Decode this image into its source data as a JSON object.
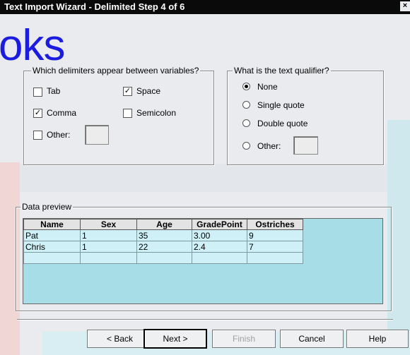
{
  "window": {
    "title": "Text Import Wizard - Delimited Step 4 of 6",
    "close_glyph": "×"
  },
  "watermark_text": "oks",
  "delimiters": {
    "legend": "Which delimiters appear between variables?",
    "tab": {
      "label": "Tab",
      "checked": false
    },
    "space": {
      "label": "Space",
      "checked": true
    },
    "comma": {
      "label": "Comma",
      "checked": true
    },
    "semicolon": {
      "label": "Semicolon",
      "checked": false
    },
    "other": {
      "label": "Other:",
      "checked": false,
      "value": ""
    },
    "check_glyph": "✓"
  },
  "qualifier": {
    "legend": "What is the text qualifier?",
    "options": [
      {
        "label": "None",
        "selected": true
      },
      {
        "label": "Single quote",
        "selected": false
      },
      {
        "label": "Double quote",
        "selected": false
      },
      {
        "label": "Other:",
        "selected": false
      }
    ],
    "other_value": ""
  },
  "preview": {
    "legend": "Data preview",
    "columns": [
      "Name",
      "Sex",
      "Age",
      "GradePoint",
      "Ostriches"
    ],
    "rows": [
      [
        "Pat",
        "1",
        "35",
        "3.00",
        "9"
      ],
      [
        "Chris",
        "1",
        "22",
        "2.4",
        "7"
      ],
      [
        "",
        "",
        "",
        "",
        ""
      ]
    ]
  },
  "buttons": {
    "back": "< Back",
    "next": "Next >",
    "finish": "Finish",
    "cancel": "Cancel",
    "help": "Help"
  }
}
